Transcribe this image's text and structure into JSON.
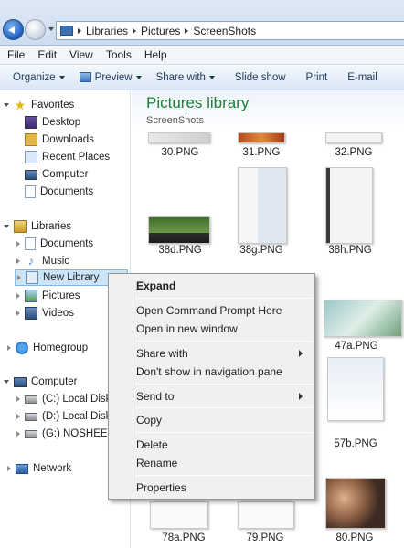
{
  "address": {
    "crumbs": [
      "Libraries",
      "Pictures",
      "ScreenShots"
    ]
  },
  "menu": [
    "File",
    "Edit",
    "View",
    "Tools",
    "Help"
  ],
  "toolbar": {
    "organize": "Organize",
    "preview": "Preview",
    "share_with": "Share with",
    "slide_show": "Slide show",
    "print": "Print",
    "email": "E-mail"
  },
  "sidebar": {
    "favorites": "Favorites",
    "desktop": "Desktop",
    "downloads": "Downloads",
    "recent_places": "Recent Places",
    "computer_fav": "Computer",
    "documents_fav": "Documents",
    "libraries": "Libraries",
    "lib_documents": "Documents",
    "lib_music": "Music",
    "lib_new_library": "New Library",
    "lib_pictures": "Pictures",
    "lib_videos": "Videos",
    "homegroup": "Homegroup",
    "computer": "Computer",
    "drive_c": "(C:) Local Disk",
    "drive_d": "(D:) Local Disk",
    "drive_g": "(G:) NOSHEEN",
    "network": "Network"
  },
  "library": {
    "title": "Pictures library",
    "subtitle": "ScreenShots"
  },
  "files": {
    "f30": "30.PNG",
    "f31": "31.PNG",
    "f32": "32.PNG",
    "f38d": "38d.PNG",
    "f38g": "38g.PNG",
    "f38h": "38h.PNG",
    "f47a": "47a.PNG",
    "f57b": "57b.PNG",
    "f78a": "78a.PNG",
    "f79": "79.PNG",
    "f80": "80.PNG"
  },
  "context_menu": {
    "expand": "Expand",
    "open_cmd": "Open Command Prompt Here",
    "open_new_window": "Open in new window",
    "share_with": "Share with",
    "dont_show": "Don't show in navigation pane",
    "send_to": "Send to",
    "copy": "Copy",
    "delete": "Delete",
    "rename": "Rename",
    "properties": "Properties"
  }
}
